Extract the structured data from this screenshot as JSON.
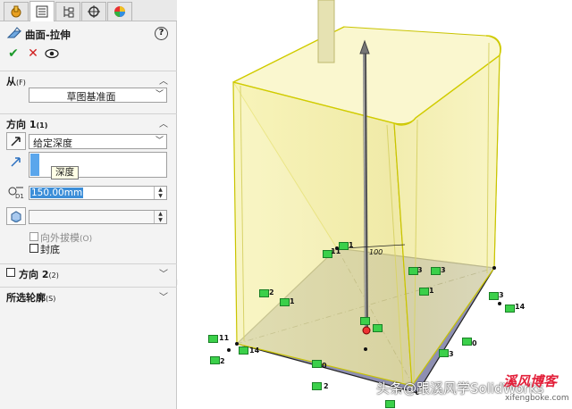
{
  "feature": {
    "title": "曲面-拉伸",
    "help_icon": "question-icon",
    "ok_icon": "check-icon",
    "cancel_icon": "x-icon",
    "preview_icon": "eye-icon"
  },
  "tabs": [
    {
      "name": "feature-manager-tab",
      "icon": "hand-icon",
      "active": false
    },
    {
      "name": "property-manager-tab",
      "icon": "list-icon",
      "active": true
    },
    {
      "name": "configuration-manager-tab",
      "icon": "config-tree-icon",
      "active": false
    },
    {
      "name": "dimxpert-tab",
      "icon": "crosshair-icon",
      "active": false
    },
    {
      "name": "display-manager-tab",
      "icon": "color-wheel-icon",
      "active": false
    }
  ],
  "from_section": {
    "label": "从",
    "suffix": "(F)",
    "start_condition": "草图基准面"
  },
  "direction1": {
    "label": "方向 1",
    "suffix": "(1)",
    "end_condition": "给定深度",
    "depth_value": "150.00mm",
    "tooltip": "深度",
    "draft_outward_label": "向外拔模",
    "draft_outward_suffix": "(O)",
    "cap_end_label": "封底"
  },
  "direction2": {
    "label": "方向 2",
    "suffix": "(2)"
  },
  "selected_contours": {
    "label": "所选轮廓",
    "suffix": "(S)"
  },
  "graphics": {
    "dimension_label": "100",
    "relation_numbers": [
      "11",
      "1",
      "3",
      "3",
      "1",
      "2",
      "1",
      "3",
      "14",
      "11",
      "14",
      "2",
      "0",
      "0",
      "3",
      "2"
    ],
    "surface_color": "#f5f0a0",
    "edge_color": "#c9c400",
    "sketch_plane_color": "#8e8fb2"
  },
  "watermark": {
    "text": "头条@跟溪风学SolidWorks",
    "blog": "溪风博客",
    "url": "xifengboke.com"
  }
}
